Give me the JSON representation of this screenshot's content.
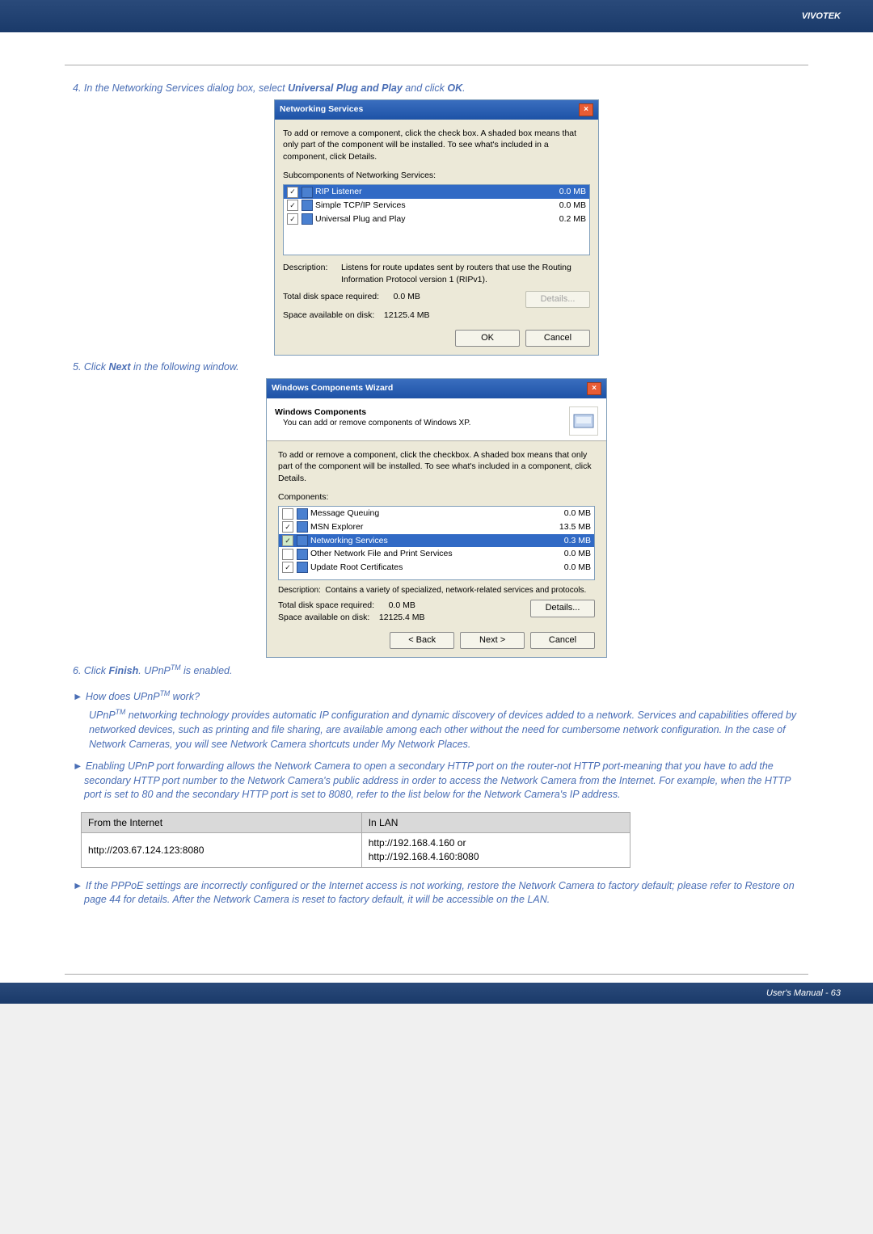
{
  "header_brand": "VIVOTEK",
  "step4_text": "4. In the Networking Services dialog box, select ",
  "step4_bold": "Universal Plug and Play",
  "step4_tail": " and click ",
  "step4_ok": "OK",
  "step4_dot": ".",
  "dlg1": {
    "title": "Networking Services",
    "intro": "To add or remove a component, click the check box. A shaded box means that only part of the component will be installed. To see what's included in a component, click Details.",
    "subcap": "Subcomponents of Networking Services:",
    "rows": [
      {
        "label": "RIP Listener",
        "size": "0.0 MB",
        "checked": true,
        "selected": true
      },
      {
        "label": "Simple TCP/IP Services",
        "size": "0.0 MB",
        "checked": true,
        "selected": false
      },
      {
        "label": "Universal Plug and Play",
        "size": "0.2 MB",
        "checked": true,
        "selected": false
      }
    ],
    "desc_label": "Description:",
    "desc_text": "Listens for route updates sent by routers that use the Routing Information Protocol version 1 (RIPv1).",
    "req_label": "Total disk space required:",
    "req_val": "0.0 MB",
    "avail_label": "Space available on disk:",
    "avail_val": "12125.4 MB",
    "details_btn": "Details...",
    "ok_btn": "OK",
    "cancel_btn": "Cancel"
  },
  "step5_text": "5. Click ",
  "step5_bold": "Next",
  "step5_tail": " in the following window.",
  "dlg2": {
    "title": "Windows Components Wizard",
    "head1": "Windows Components",
    "head2": "You can add or remove components of Windows XP.",
    "intro": "To add or remove a component, click the checkbox. A shaded box means that only part of the component will be installed. To see what's included in a component, click Details.",
    "subcap": "Components:",
    "rows": [
      {
        "label": "Message Queuing",
        "size": "0.0 MB",
        "checked": false,
        "shaded": false,
        "selected": false
      },
      {
        "label": "MSN Explorer",
        "size": "13.5 MB",
        "checked": true,
        "shaded": false,
        "selected": false
      },
      {
        "label": "Networking Services",
        "size": "0.3 MB",
        "checked": true,
        "shaded": true,
        "selected": true
      },
      {
        "label": "Other Network File and Print Services",
        "size": "0.0 MB",
        "checked": false,
        "shaded": false,
        "selected": false
      },
      {
        "label": "Update Root Certificates",
        "size": "0.0 MB",
        "checked": true,
        "shaded": false,
        "selected": false
      }
    ],
    "desc_label": "Description:",
    "desc_text": "Contains a variety of specialized, network-related services and protocols.",
    "req_label": "Total disk space required:",
    "req_val": "0.0 MB",
    "avail_label": "Space available on disk:",
    "avail_val": "12125.4 MB",
    "details_btn": "Details...",
    "back_btn": "< Back",
    "next_btn": "Next >",
    "cancel_btn": "Cancel"
  },
  "step6_pre": "6. Click ",
  "step6_bold": "Finish",
  "step6_mid": ". UPnP",
  "step6_tm": "TM",
  "step6_tail": " is enabled.",
  "faq1_q_pre": "► How does UPnP",
  "faq1_q_tm": "TM",
  "faq1_q_tail": " work?",
  "faq1_a_pre": "UPnP",
  "faq1_a_tm": "TM",
  "faq1_a_text": " networking technology provides automatic IP configuration and dynamic discovery of devices added to a network. Services and capabilities offered by networked devices, such as printing and file sharing, are available among each other without the need for cumbersome network configuration. In the case of Network Cameras, you will see Network Camera shortcuts under My Network Places.",
  "faq2_text": "► Enabling UPnP port forwarding allows the Network Camera to open a secondary HTTP port on the router-not HTTP port-meaning that you have to add the secondary HTTP port number to the Network Camera's public address in order to access the Network Camera from the Internet. For example, when the HTTP port is set to 80 and the secondary HTTP port is set to 8080, refer to the list below for the Network Camera's IP address.",
  "table": {
    "h1": "From the Internet",
    "h2": "In LAN",
    "c1": "http://203.67.124.123:8080",
    "c2a": "http://192.168.4.160 or",
    "c2b": "http://192.168.4.160:8080"
  },
  "faq3_text": "► If the PPPoE settings are incorrectly configured or the Internet access is not working, restore the Network Camera to factory default; please refer to Restore on page 44 for details. After the Network Camera is reset to factory default, it will be accessible on the LAN.",
  "footer_text": "User's Manual - 63"
}
